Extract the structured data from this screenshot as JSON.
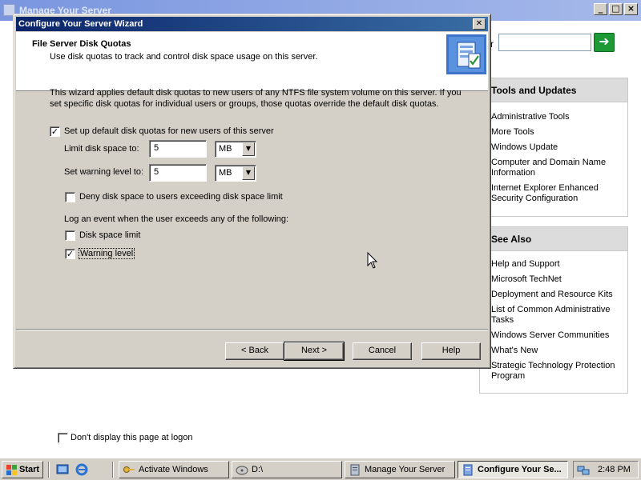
{
  "background_window": {
    "title": "Manage Your Server",
    "search_label": "r",
    "tools_panel": {
      "heading": "Tools and Updates",
      "links": [
        "Administrative Tools",
        "More Tools",
        "Windows Update",
        "Computer and Domain Name Information",
        "Internet Explorer Enhanced Security Configuration"
      ]
    },
    "see_also_panel": {
      "heading": "See Also",
      "links": [
        "Help and Support",
        "Microsoft TechNet",
        "Deployment and Resource Kits",
        "List of Common Administrative Tasks",
        "Windows Server Communities",
        "What's New",
        "Strategic Technology Protection Program"
      ]
    },
    "dont_display_label": "Don't display this page at logon",
    "dont_display_checked": false
  },
  "dialog": {
    "title": "Configure Your Server Wizard",
    "close_glyph": "✕",
    "header_title": "File Server Disk Quotas",
    "header_subtitle": "Use disk quotas to track and control disk space usage on this server.",
    "intro": "This wizard applies default disk quotas to new users of any NTFS file system volume on this server. If you set specific disk quotas for individual users or groups, those quotas override the default disk quotas.",
    "setup_default_label": "Set up default disk quotas for new users of this server",
    "setup_default_checked": true,
    "limit_label": "Limit disk space to:",
    "limit_value": "5",
    "limit_unit": "MB",
    "warning_label": "Set warning level to:",
    "warning_value": "5",
    "warning_unit": "MB",
    "deny_label": "Deny disk space to users exceeding disk space limit",
    "deny_checked": false,
    "log_event_label": "Log an event when the user exceeds any of the following:",
    "log_limit_label": "Disk space limit",
    "log_limit_checked": false,
    "log_warning_label": "Warning level",
    "log_warning_checked": true,
    "buttons": {
      "back": "< Back",
      "next": "Next >",
      "cancel": "Cancel",
      "help": "Help"
    }
  },
  "taskbar": {
    "start": "Start",
    "items": [
      "Activate Windows",
      "D:\\",
      "Manage Your Server",
      "Configure Your Se..."
    ],
    "clock": "2:48 PM"
  },
  "colors": {
    "dialog_title_start": "#0a246a",
    "dialog_title_end": "#3a6ea5",
    "face": "#d4d0c8",
    "go_button": "#1d9a35"
  }
}
